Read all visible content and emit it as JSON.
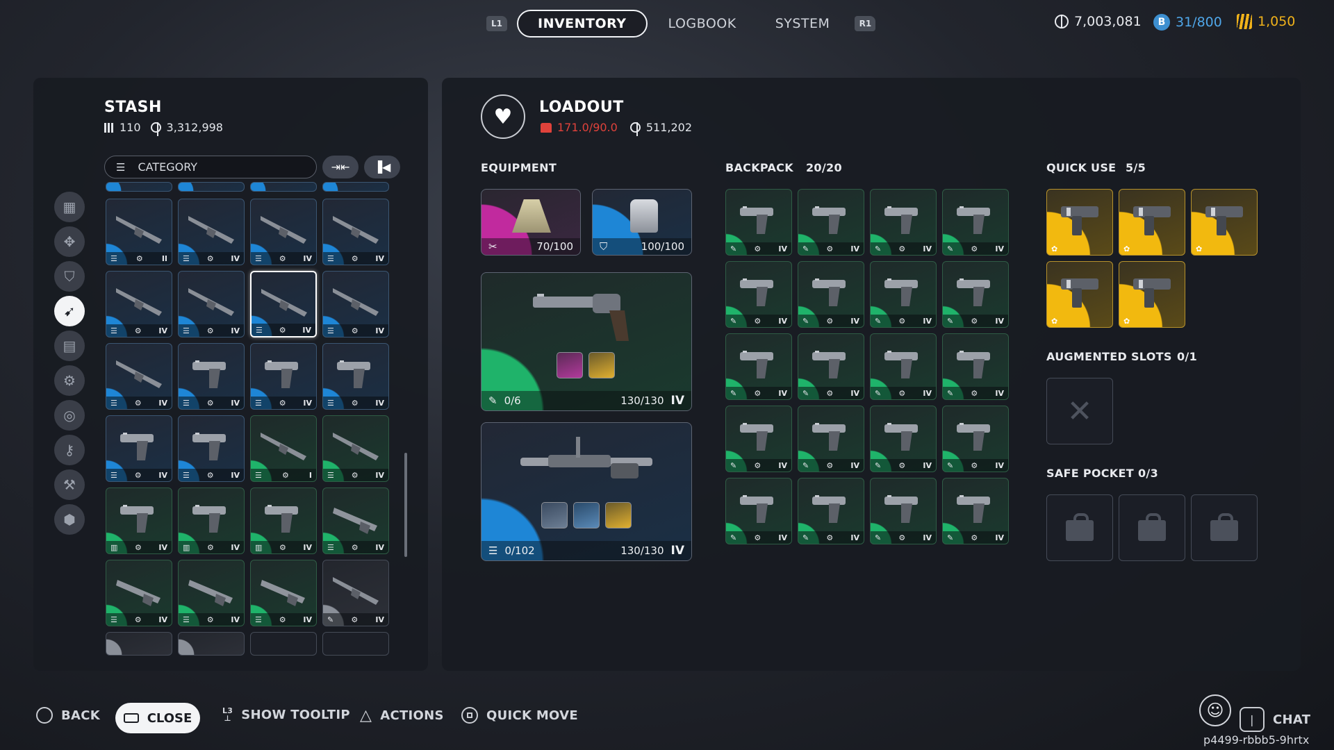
{
  "nav": {
    "left_shoulder": "L1",
    "right_shoulder": "R1",
    "tabs": [
      "INVENTORY",
      "LOGBOOK",
      "SYSTEM"
    ]
  },
  "currencies": {
    "credits": "7,003,081",
    "tokens": "31/800",
    "gold": "1,050"
  },
  "stash": {
    "title": "STASH",
    "count": "110",
    "value": "3,312,998",
    "category_label": "CATEGORY",
    "sidebar_icons": [
      "grid-icon",
      "gear-parts-icon",
      "shield-icon",
      "gun-icon",
      "book-icon",
      "cog-icon",
      "ring-icon",
      "key-icon",
      "wrench-icon",
      "box-icon"
    ],
    "active_sidebar": "gun-icon",
    "rows": [
      [
        {
          "r": "blue",
          "g": "rifle",
          "t": "II"
        },
        {
          "r": "blue",
          "g": "rifle",
          "t": "IV"
        },
        {
          "r": "blue",
          "g": "rifle",
          "t": "IV"
        },
        {
          "r": "blue",
          "g": "rifle",
          "t": "IV"
        }
      ],
      [
        {
          "r": "blue",
          "g": "rifle",
          "t": "IV"
        },
        {
          "r": "blue",
          "g": "rifle",
          "t": "IV"
        },
        {
          "r": "blue",
          "g": "rifle",
          "t": "IV",
          "sel": true
        },
        {
          "r": "blue",
          "g": "rifle",
          "t": "IV"
        }
      ],
      [
        {
          "r": "blue",
          "g": "rifle",
          "t": "IV"
        },
        {
          "r": "blue",
          "g": "pistol",
          "t": "IV"
        },
        {
          "r": "blue",
          "g": "pistol",
          "t": "IV"
        },
        {
          "r": "blue",
          "g": "pistol",
          "t": "IV"
        }
      ],
      [
        {
          "r": "blue",
          "g": "pistol",
          "t": "IV"
        },
        {
          "r": "blue",
          "g": "pistol",
          "t": "IV"
        },
        {
          "r": "green",
          "g": "rifle",
          "t": "I"
        },
        {
          "r": "green",
          "g": "rifle",
          "t": "IV"
        }
      ],
      [
        {
          "r": "green",
          "g": "pistol",
          "t": "IV"
        },
        {
          "r": "green",
          "g": "pistol",
          "t": "IV"
        },
        {
          "r": "green",
          "g": "pistol",
          "t": "IV"
        },
        {
          "r": "green",
          "g": "shotgun",
          "t": "IV"
        }
      ],
      [
        {
          "r": "green",
          "g": "shotgun",
          "t": "IV"
        },
        {
          "r": "green",
          "g": "shotgun",
          "t": "IV"
        },
        {
          "r": "green",
          "g": "shotgun",
          "t": "IV"
        },
        {
          "r": "gray",
          "g": "rifle",
          "t": "IV"
        }
      ]
    ]
  },
  "loadout": {
    "title": "LOADOUT",
    "weight": "171.0/90.0",
    "value": "511,202",
    "equipment_label": "EQUIPMENT",
    "equipment": [
      {
        "name": "augment",
        "value": "70/100"
      },
      {
        "name": "shield",
        "value": "100/100"
      }
    ],
    "weapons": [
      {
        "ammo": "0/6",
        "durability": "130/130",
        "tier": "IV"
      },
      {
        "ammo": "0/102",
        "durability": "130/130",
        "tier": "IV"
      }
    ],
    "backpack_label": "BACKPACK",
    "backpack_count": "20/20",
    "backpack_tier": "IV",
    "quick_use_label": "QUICK USE",
    "quick_use_count": "5/5",
    "augmented_label": "AUGMENTED SLOTS",
    "augmented_count": "0/1",
    "safe_pocket_label": "SAFE POCKET",
    "safe_pocket_count": "0/3"
  },
  "footer": {
    "back": "BACK",
    "close": "CLOSE",
    "l3": "L3",
    "tooltip": "SHOW TOOLTIP",
    "actions": "ACTIONS",
    "quick_move": "QUICK MOVE",
    "chat": "CHAT",
    "user_id": "p4499-rbbb5-9hrtx"
  },
  "colors": {
    "rarity_blue": "#1e86d6",
    "rarity_green": "#1fb36a",
    "rarity_gold": "#f2b90f",
    "overweight_red": "#e0423b"
  }
}
